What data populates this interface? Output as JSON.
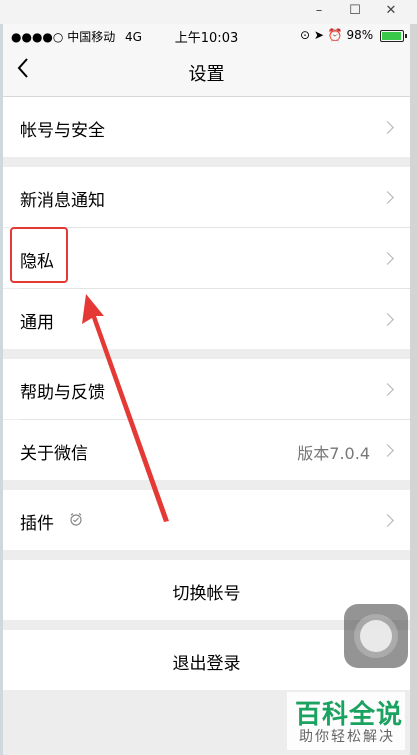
{
  "window": {
    "minimize": "–",
    "maximize": "☐",
    "close": "✕"
  },
  "status_bar": {
    "signal": "●●●●○",
    "carrier": "中国移动",
    "network": "4G",
    "time": "上午10:03",
    "battery": "98%"
  },
  "nav": {
    "back_icon": "chevron-left",
    "title": "设置"
  },
  "sections": {
    "account": {
      "label": "帐号与安全"
    },
    "notifications": {
      "label": "新消息通知"
    },
    "privacy": {
      "label": "隐私"
    },
    "general": {
      "label": "通用"
    },
    "help": {
      "label": "帮助与反馈"
    },
    "about": {
      "label": "关于微信",
      "version": "版本7.0.4"
    },
    "plugins": {
      "label": "插件"
    },
    "switch_account": {
      "label": "切换帐号"
    },
    "logout": {
      "label": "退出登录"
    }
  },
  "annotation": {
    "color": "#e53935"
  },
  "watermark": {
    "title": "百科全说",
    "subtitle": "助你轻松解决"
  }
}
